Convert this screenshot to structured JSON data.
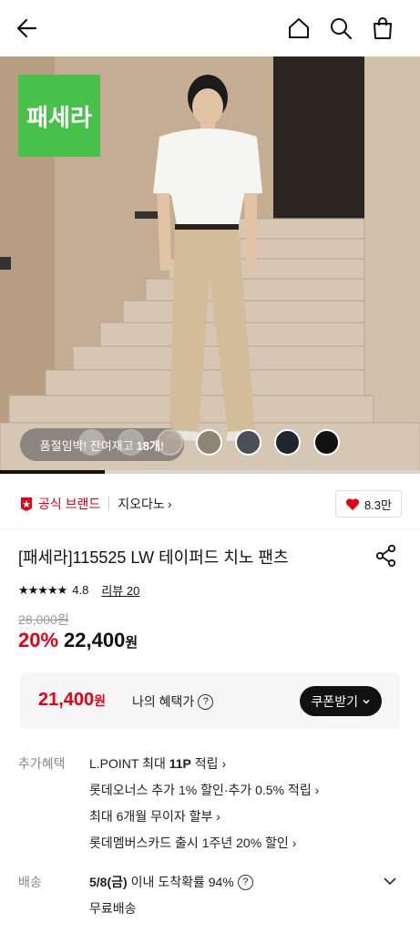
{
  "header": {
    "back_icon": "arrow-left-icon",
    "home_icon": "home-icon",
    "search_icon": "search-icon",
    "cart_icon": "shopping-bag-icon"
  },
  "hero": {
    "brand_logo_text": "패세라",
    "brand_logo_color": "#48c14a",
    "stock_prefix": "품절임박! 잔여재고",
    "stock_count": "18개!",
    "color_swatches": [
      "#ffffff",
      "#e8e8e8",
      "#d9c8b0",
      "#8e8474",
      "#4b4f58",
      "#1f2630",
      "#111111"
    ],
    "image_progress": 0.25
  },
  "brand": {
    "official_label": "공식 브랜드",
    "official_color": "#e60012",
    "brand_name": "지오다노",
    "like_count": "8.3만"
  },
  "product": {
    "title": "[패세라]115525 LW 테이퍼드 치노 팬츠",
    "rating_stars": "★★★★★",
    "rating_value": "4.8",
    "review_label": "리뷰 20",
    "original_price": "28,000원",
    "discount_rate": "20%",
    "sale_price": "22,400",
    "sale_price_unit": "원"
  },
  "my_benefit": {
    "price": "21,400",
    "price_unit": "원",
    "label": "나의 혜택가",
    "coupon_button": "쿠폰받기"
  },
  "extra_benefits": {
    "label": "추가혜택",
    "items": [
      {
        "prefix": "L.POINT 최대 ",
        "bold": "11P",
        "suffix": " 적립"
      },
      {
        "prefix": "롯데오너스 추가 1% 할인·추가 0.5% 적립",
        "bold": "",
        "suffix": ""
      },
      {
        "prefix": "최대 6개월 무이자 할부",
        "bold": "",
        "suffix": ""
      },
      {
        "prefix": "롯데멤버스카드 출시 1주년 20% 할인",
        "bold": "",
        "suffix": ""
      }
    ]
  },
  "shipping": {
    "label": "배송",
    "date_bold": "5/8(금)",
    "date_text": "이내 도착확률 94%",
    "fee": "무료배송"
  }
}
